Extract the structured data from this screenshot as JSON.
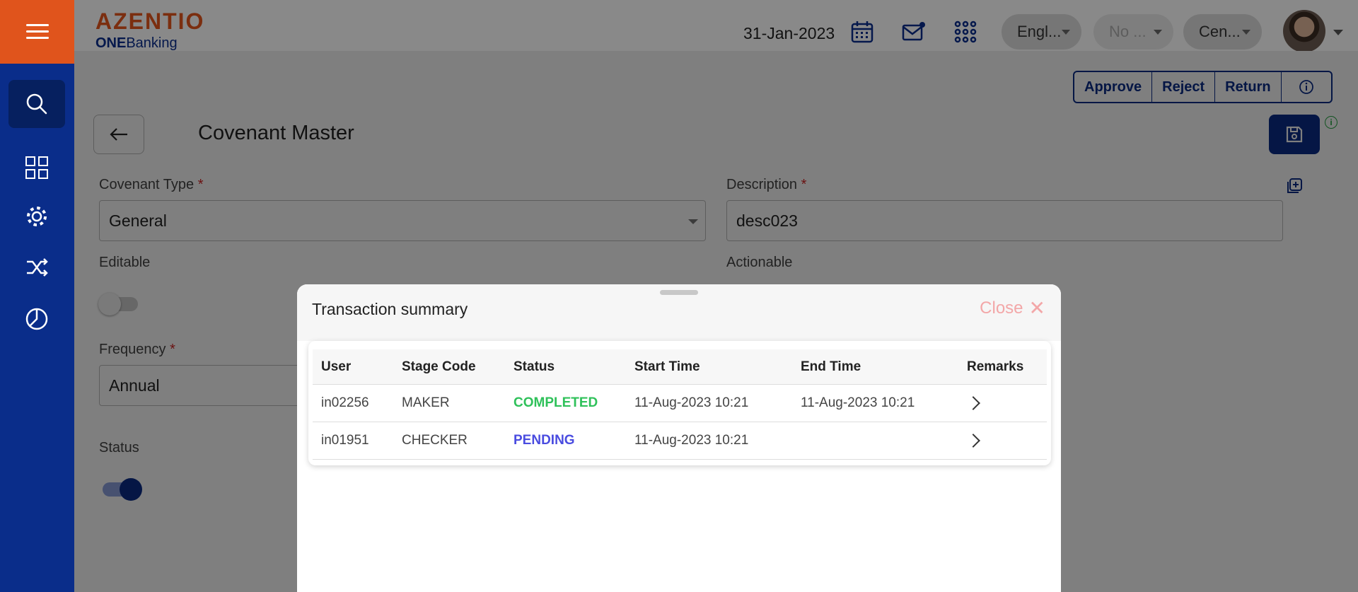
{
  "header": {
    "logo_main": "AZENTIO",
    "logo_sub_bold": "ONE",
    "logo_sub_rest": "Banking",
    "date": "31-Jan-2023",
    "language_pill": "Engl...",
    "second_pill": "No ...",
    "third_pill": "Cen..."
  },
  "toolbar": {
    "approve": "Approve",
    "reject": "Reject",
    "return": "Return"
  },
  "page": {
    "title": "Covenant Master"
  },
  "form": {
    "covenant_type_label": "Covenant Type",
    "covenant_type_value": "General",
    "description_label": "Description",
    "description_value": "desc023",
    "editable_label": "Editable",
    "actionable_label": "Actionable",
    "frequency_label": "Frequency",
    "frequency_value": "Annual",
    "status_label": "Status",
    "required_mark": "*"
  },
  "modal": {
    "title": "Transaction summary",
    "close_label": "Close",
    "columns": [
      "User",
      "Stage Code",
      "Status",
      "Start Time",
      "End Time",
      "Remarks"
    ],
    "rows": [
      {
        "user": "in02256",
        "stage": "MAKER",
        "status": "COMPLETED",
        "start": "11-Aug-2023 10:21",
        "end": "11-Aug-2023 10:21"
      },
      {
        "user": "in01951",
        "stage": "CHECKER",
        "status": "PENDING",
        "start": "11-Aug-2023 10:21",
        "end": ""
      }
    ]
  },
  "colors": {
    "brand_orange": "#e0541c",
    "brand_navy": "#0a2d8a",
    "completed": "#2fc15a",
    "pending": "#4a4ce0"
  }
}
